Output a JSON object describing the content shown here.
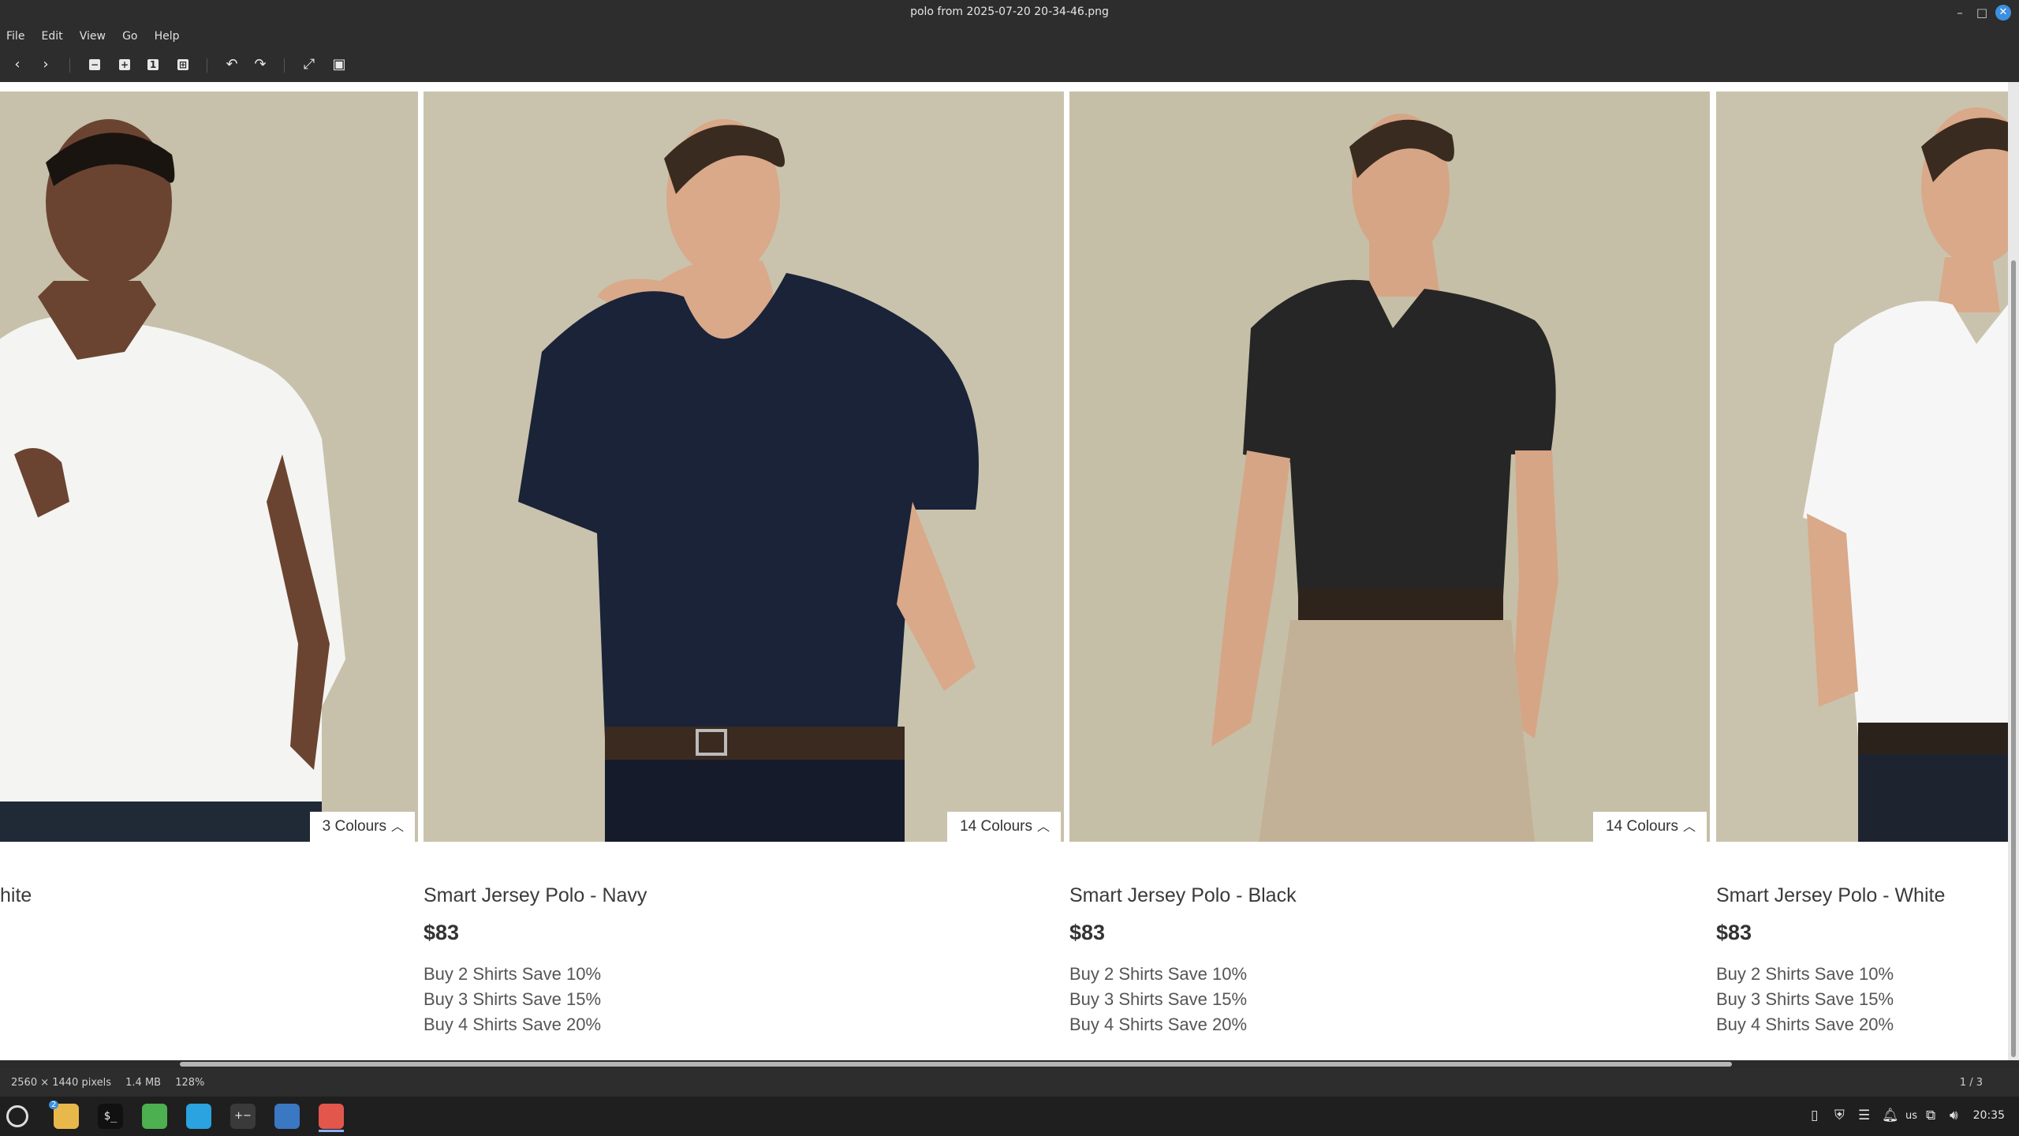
{
  "window": {
    "title": "polo  from 2025-07-20 20-34-46.png",
    "controls": {
      "minimize": "–",
      "maximize": "□",
      "close": "✕"
    }
  },
  "menu": [
    "File",
    "Edit",
    "View",
    "Go",
    "Help"
  ],
  "toolbar": {
    "back": "‹",
    "forward": "›",
    "zoom_out": "−",
    "zoom_in": "+",
    "zoom_normal": "1",
    "zoom_fit": "⊞",
    "rotate_left": "↶",
    "rotate_right": "↷",
    "fullscreen": "⤢",
    "slideshow": "▣"
  },
  "products": [
    {
      "name": "hite",
      "price": "",
      "promos": [],
      "colours": "3 Colours",
      "shirt": "#f4f4f2",
      "pants": "#1f2a36",
      "skin": "#6b4431"
    },
    {
      "name": "Smart Jersey Polo - Navy",
      "price": "$83",
      "promos": [
        "Buy 2 Shirts Save 10%",
        "Buy 3 Shirts Save 15%",
        "Buy 4 Shirts Save 20%"
      ],
      "colours": "14 Colours",
      "shirt": "#1a2338",
      "pants": "#151b2b",
      "skin": "#d9a98a"
    },
    {
      "name": "Smart Jersey Polo - Black",
      "price": "$83",
      "promos": [
        "Buy 2 Shirts Save 10%",
        "Buy 3 Shirts Save 15%",
        "Buy 4 Shirts Save 20%"
      ],
      "colours": "14 Colours",
      "shirt": "#262626",
      "pants": "#c3b197",
      "skin": "#d6a586"
    },
    {
      "name": "Smart Jersey Polo - White",
      "price": "$83",
      "promos": [
        "Buy 2 Shirts Save 10%",
        "Buy 3 Shirts Save 15%",
        "Buy 4 Shirts Save 20%"
      ],
      "colours": "",
      "shirt": "#f6f6f6",
      "pants": "#1d2430",
      "skin": "#d9a98a"
    }
  ],
  "status": {
    "dimensions": "2560 × 1440 pixels",
    "size": "1.4 MB",
    "zoom": "128%",
    "position": "1 / 3"
  },
  "taskbar": {
    "apps": [
      "menu-icon",
      "files-icon",
      "terminal-icon",
      "spreadsheet-icon",
      "browser-icon",
      "calculator-icon",
      "screenshot-icon",
      "image-viewer-icon"
    ],
    "files_badge": "2",
    "tray": {
      "keyboard_layout": "us"
    },
    "clock": "20:35"
  }
}
